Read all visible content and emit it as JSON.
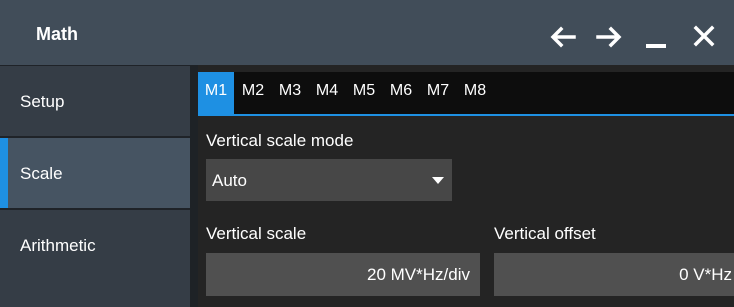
{
  "window": {
    "title": "Math",
    "controls": {
      "back_icon": "arrow-left-icon",
      "forward_icon": "arrow-right-icon",
      "minimize_icon": "minimize-icon",
      "close_icon": "close-icon"
    }
  },
  "sidebar": {
    "items": [
      {
        "label": "Setup",
        "active": false
      },
      {
        "label": "Scale",
        "active": true
      },
      {
        "label": "Arithmetic",
        "active": false
      }
    ]
  },
  "tabs": [
    {
      "label": "M1",
      "active": true
    },
    {
      "label": "M2",
      "active": false
    },
    {
      "label": "M3",
      "active": false
    },
    {
      "label": "M4",
      "active": false
    },
    {
      "label": "M5",
      "active": false
    },
    {
      "label": "M6",
      "active": false
    },
    {
      "label": "M7",
      "active": false
    },
    {
      "label": "M8",
      "active": false
    }
  ],
  "scale": {
    "mode_label": "Vertical scale mode",
    "mode_value": "Auto",
    "vscale_label": "Vertical scale",
    "vscale_value": "20 MV*Hz/div",
    "voffset_label": "Vertical offset",
    "voffset_value": "0 V*Hz"
  },
  "colors": {
    "accent": "#1e90e3",
    "titlebar": "#414d59",
    "sidebar_item": "#353d46",
    "sidebar_active": "#465462"
  }
}
